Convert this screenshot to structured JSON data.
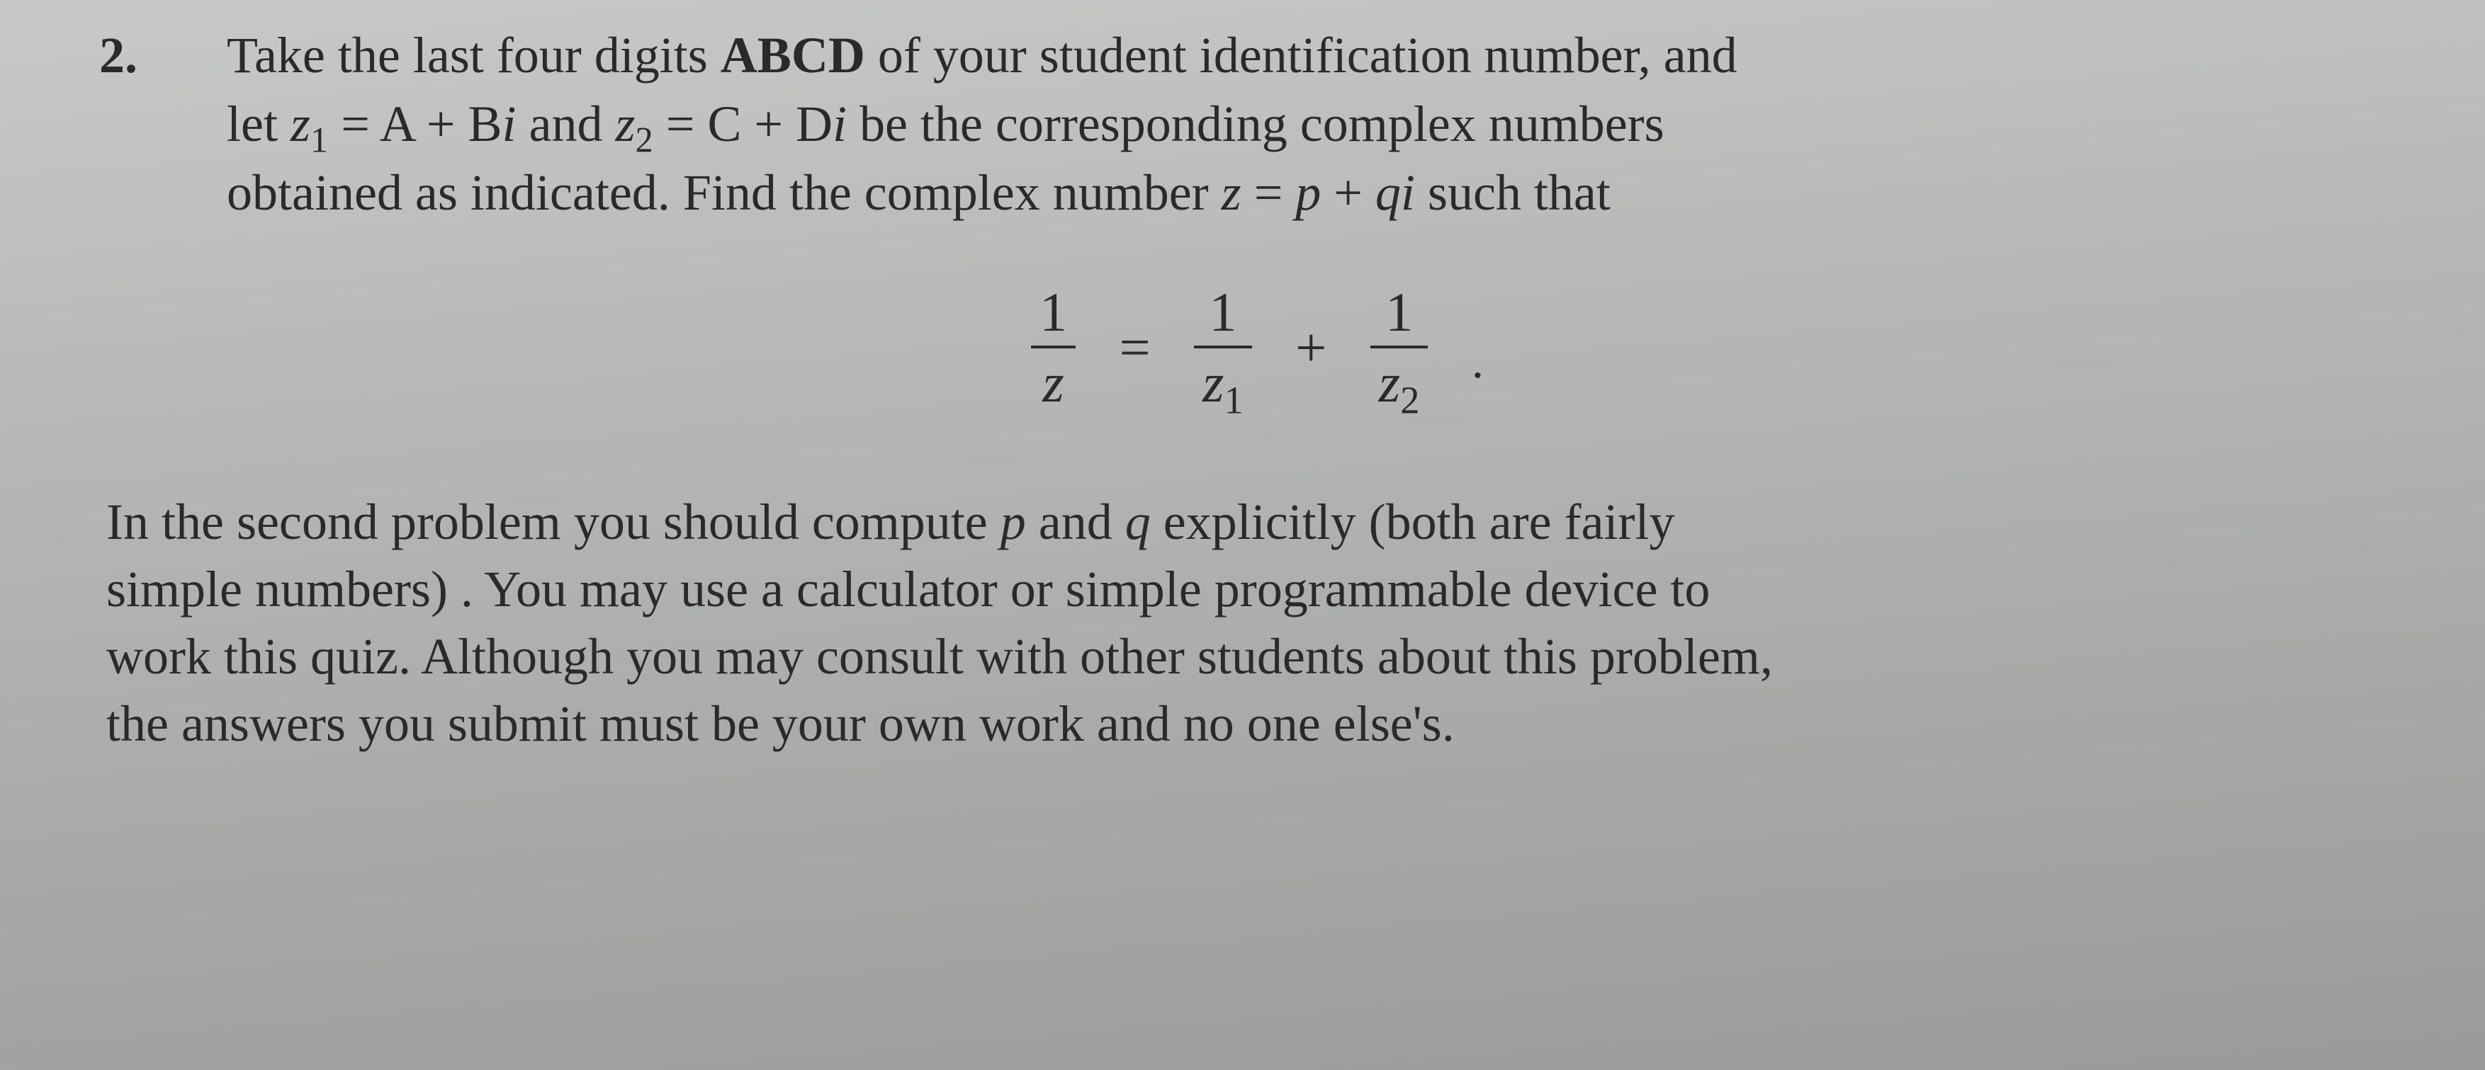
{
  "problem": {
    "number": "2.",
    "line1_a": "Take the last four digits ",
    "abcd": "ABCD",
    "line1_b": " of your student identification number, and",
    "line2_a": "let ",
    "z1": "z",
    "z1_sub": "1",
    "eq1": "  =   ",
    "AB": "A + B",
    "i1": "i",
    "and": "  and ",
    "z2": "z",
    "z2_sub": "2",
    "eq2": "   =   ",
    "CD": "C + D",
    "i2": "i",
    "line2_b": "  be the corresponding complex numbers",
    "line3_a": "obtained as indicated.  Find the complex number  ",
    "z": "z",
    "eq3": "  =  ",
    "p": "p",
    "plus": " + ",
    "q": "q",
    "i3": "i",
    "line3_b": "  such that"
  },
  "equation": {
    "num1": "1",
    "den1": "z",
    "eq": "=",
    "num2": "1",
    "den2_z": "z",
    "den2_sub": "1",
    "plus": "+",
    "num3": "1",
    "den3_z": "z",
    "den3_sub": "2",
    "period": "."
  },
  "footer": {
    "line1_a": "In the second problem you should compute ",
    "p": "p",
    "line1_b": " and ",
    "q": "q",
    "line1_c": " explicitly (both are fairly",
    "line2": "simple numbers) .  You may use a calculator or simple programmable device to",
    "line3": "work this quiz.  Although you may consult with other students about this problem,",
    "line4": "the answers you submit must be your own work and no one else's."
  }
}
